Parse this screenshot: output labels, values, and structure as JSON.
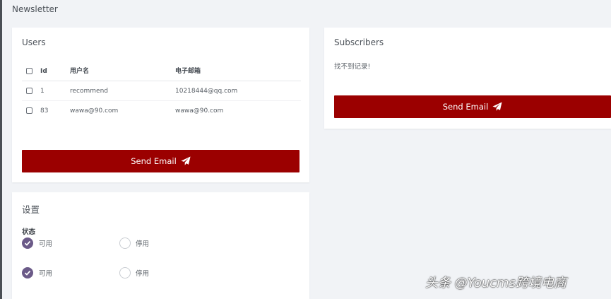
{
  "page": {
    "title": "Newsletter"
  },
  "users": {
    "title": "Users",
    "columns": [
      "Id",
      "用户名",
      "电子邮箱"
    ],
    "rows": [
      {
        "id": "1",
        "username": "recommend",
        "email": "10218444@qq.com"
      },
      {
        "id": "83",
        "username": "wawa@90.com",
        "email": "wawa@90.com"
      }
    ],
    "send_label": "Send Email"
  },
  "subscribers": {
    "title": "Subscribers",
    "empty_text": "找不到记录!",
    "send_label": "Send Email"
  },
  "settings": {
    "title": "设置",
    "status_label": "状态",
    "groups": [
      {
        "enabled_label": "可用",
        "disabled_label": "停用",
        "selected": "enabled"
      },
      {
        "enabled_label": "可用",
        "disabled_label": "停用",
        "selected": "enabled"
      }
    ]
  },
  "watermark": {
    "text": "头条 @Youcms跨境电商"
  },
  "colors": {
    "accent": "#9b0000",
    "radio_selected": "#6b5a88",
    "background": "#f1f3f6"
  }
}
